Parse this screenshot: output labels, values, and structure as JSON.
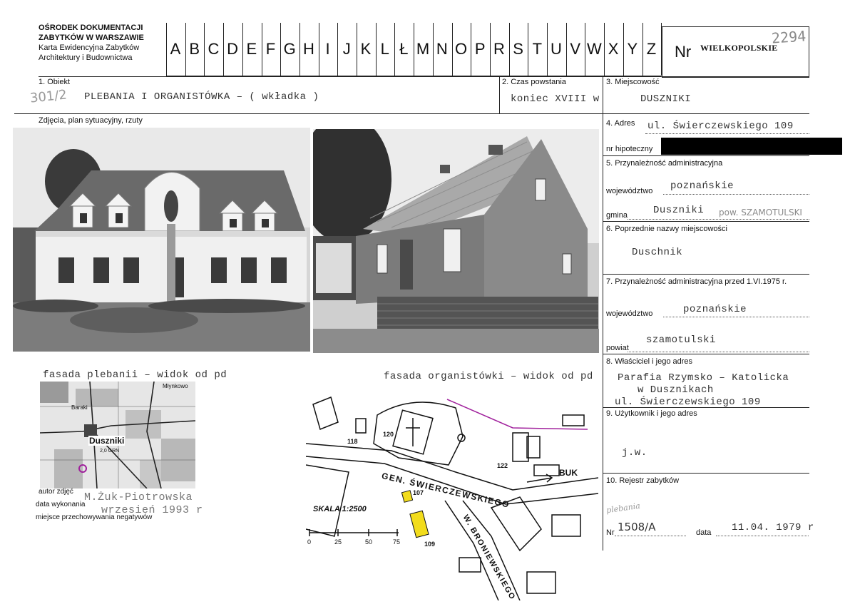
{
  "header": {
    "institution_lines": [
      "OŚRODEK DOKUMENTACJI",
      "ZABYTKÓW W WARSZAWIE",
      "Karta Ewidencyjna Zabytków",
      "Architektury  i  Budownictwa"
    ],
    "letters": [
      "A",
      "B",
      "C",
      "D",
      "E",
      "F",
      "G",
      "H",
      "I",
      "J",
      "K",
      "L",
      "Ł",
      "M",
      "N",
      "O",
      "P",
      "R",
      "S",
      "T",
      "U",
      "V",
      "W",
      "X",
      "Y",
      "Z"
    ],
    "nr_label": "Nr",
    "region": "WIELKOPOLSKIE",
    "inventory_handwritten": "2294"
  },
  "field1": {
    "label": "1. Obiekt",
    "hand_note": "301/2",
    "value": "PLEBANIA  I   ORGANISTÓWKA  – ( wkładka )"
  },
  "field2": {
    "label": "2. Czas powstania",
    "value": "koniec XVIII  w"
  },
  "field3": {
    "label": "3. Miejscowość",
    "value": "DUSZNIKI"
  },
  "photos_label": "Zdjęcia, plan sytuacyjny, rzuty",
  "field4": {
    "label": "4. Adres",
    "value": "ul. Świerczewskiego 109",
    "nr_hip_label": "nr hipoteczny"
  },
  "field5": {
    "label": "5. Przynależność administracyjna",
    "woj_label": "województwo",
    "woj_value": "poznańskie",
    "gmina_label": "gmina",
    "gmina_value": "Duszniki",
    "gmina_hand": "pow. SZAMOTULSKI"
  },
  "field6": {
    "label": "6. Poprzednie nazwy miejscowości",
    "value": "Duschnik"
  },
  "field7": {
    "label": "7. Przynależność administracyjna przed 1.VI.1975 r.",
    "woj_label": "województwo",
    "woj_value": "poznańskie",
    "powiat_label": "powiat",
    "powiat_value": "szamotulski"
  },
  "field8": {
    "label": "8. Właściciel i jego adres",
    "lines": [
      "Parafia Rzymsko – Katolicka",
      "w Dusznikach",
      "ul. Świerczewskiego 109"
    ]
  },
  "field9": {
    "label": "9. Użytkownik i jego adres",
    "value": "j.w."
  },
  "field10": {
    "label": "10. Rejestr zabytków",
    "hand_note": "plebania",
    "nr_label": "Nr",
    "nr_value": "1508/A",
    "data_label": "data",
    "data_value": "11.04. 1979 r"
  },
  "captions": {
    "photo1": "fasada plebanii – widok od pd",
    "photo2": "fasada organistówki – widok od pd"
  },
  "credits": {
    "author_label": "autor zdjęć",
    "author_value": "M.Żuk-Piotrowska",
    "date_label": "data wykonania",
    "date_value": "wrzesień 1993 r",
    "neg_label": "miejsce przechowywania negatywów"
  },
  "topo_map": {
    "labels": [
      "Młynkowo",
      "Baraki",
      "Duszniki",
      "2,0 GRN"
    ]
  },
  "site_plan": {
    "street1": "GEN. ŚWIERCZEWSKIEGO",
    "street2": "W. BRONIEWSKIEGO",
    "direction": "BUK",
    "scale_label": "SKALA 1:2500",
    "scale_ticks": [
      "0",
      "25",
      "50",
      "75"
    ],
    "numbers": [
      "118",
      "120",
      "122",
      "107",
      "109"
    ],
    "colors": {
      "highlight": "#f2dc1c",
      "annotation": "#a0209c"
    }
  }
}
